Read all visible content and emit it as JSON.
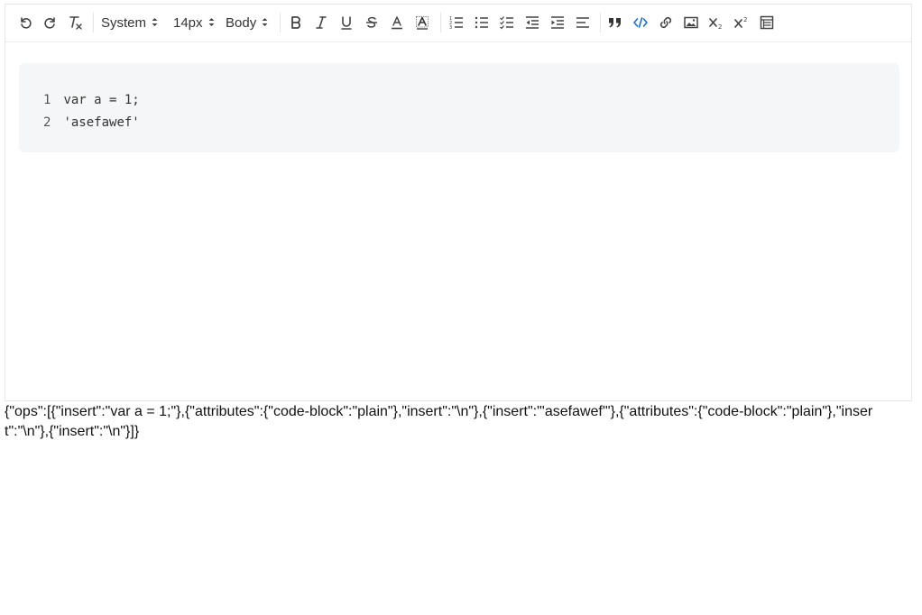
{
  "toolbar": {
    "font_family": "System",
    "font_size": "14px",
    "heading": "Body",
    "icons": {
      "undo": "undo-icon",
      "redo": "redo-icon",
      "clear_format": "clear-format-icon",
      "bold": "bold-icon",
      "italic": "italic-icon",
      "underline": "underline-icon",
      "strike": "strikethrough-icon",
      "color": "text-color-icon",
      "background": "background-color-icon",
      "ordered_list": "ordered-list-icon",
      "bullet_list": "bullet-list-icon",
      "check_list": "check-list-icon",
      "outdent": "outdent-icon",
      "indent": "indent-icon",
      "align": "align-left-icon",
      "blockquote": "blockquote-icon",
      "code_block": "code-block-icon",
      "link": "link-icon",
      "image": "image-icon",
      "subscript": "subscript-icon",
      "superscript": "superscript-icon",
      "table": "table-icon"
    },
    "active_color": "#1a6fd1"
  },
  "code_block": {
    "lines": [
      {
        "number": "1",
        "text": "var a = 1;"
      },
      {
        "number": "2",
        "text": "'asefawef'"
      }
    ]
  },
  "delta_output": "{\"ops\":[{\"insert\":\"var a = 1;\"},{\"attributes\":{\"code-block\":\"plain\"},\"insert\":\"\\n\"},{\"insert\":\"'asefawef'\"},{\"attributes\":{\"code-block\":\"plain\"},\"insert\":\"\\n\"},{\"insert\":\"\\n\"}]}"
}
